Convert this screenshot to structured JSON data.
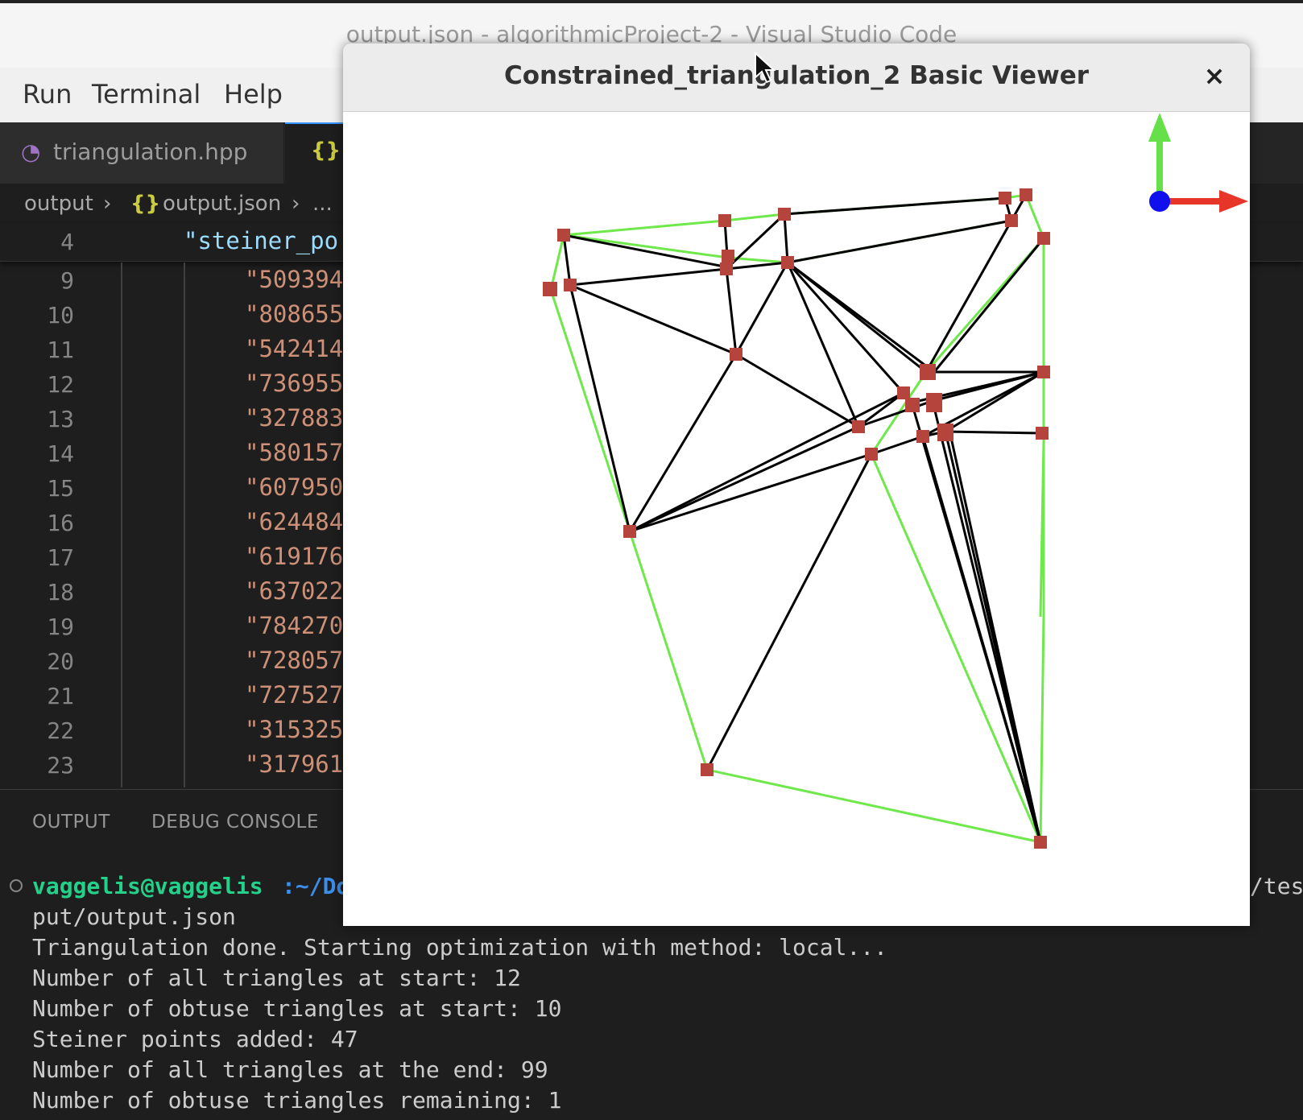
{
  "vscode": {
    "title": "output.json - algorithmicProject-2 - Visual Studio Code",
    "menu": [
      "Run",
      "Terminal",
      "Help"
    ],
    "tabs": [
      {
        "icon": "C++ icon",
        "label": "triangulation.hpp"
      },
      {
        "icon": "{}"
      }
    ],
    "breadcrumb": {
      "folder": "output",
      "icon": "{}",
      "file": "output.json",
      "more": "..."
    },
    "sticky": {
      "line": "4",
      "code": "\"steiner_po"
    },
    "code_lines": [
      {
        "n": "9",
        "text": "\"509394"
      },
      {
        "n": "10",
        "text": "\"808655"
      },
      {
        "n": "11",
        "text": "\"542414"
      },
      {
        "n": "12",
        "text": "\"736955"
      },
      {
        "n": "13",
        "text": "\"327883"
      },
      {
        "n": "14",
        "text": "\"580157"
      },
      {
        "n": "15",
        "text": "\"607950"
      },
      {
        "n": "16",
        "text": "\"624484"
      },
      {
        "n": "17",
        "text": "\"619176"
      },
      {
        "n": "18",
        "text": "\"637022"
      },
      {
        "n": "19",
        "text": "\"784270"
      },
      {
        "n": "20",
        "text": "\"728057"
      },
      {
        "n": "21",
        "text": "\"727527"
      },
      {
        "n": "22",
        "text": "\"315325"
      },
      {
        "n": "23",
        "text": "\"317961"
      }
    ],
    "panel_tabs": [
      "OUTPUT",
      "DEBUG CONSOLE"
    ],
    "terminal": {
      "user": "vaggelis@vaggelis",
      "path": ":~/Do",
      "tail": "/tes",
      "lines": [
        "put/output.json",
        "Triangulation done. Starting optimization with method: local...",
        "Number of all triangles at start: 12",
        "Number of obtuse triangles at start: 10",
        "Steiner points added: 47",
        "Number of all triangles at the end: 99",
        "Number of obtuse triangles remaining: 1"
      ]
    }
  },
  "viewer": {
    "title": "Constrained_triangulation_2 Basic Viewer",
    "close": "×",
    "colors": {
      "constraint": "#6ee84a",
      "edge": "#000000",
      "vertex": "#b5443c",
      "axis_x": "#e8352a",
      "axis_y": "#66e048",
      "axis_origin": "#1010ee"
    }
  }
}
